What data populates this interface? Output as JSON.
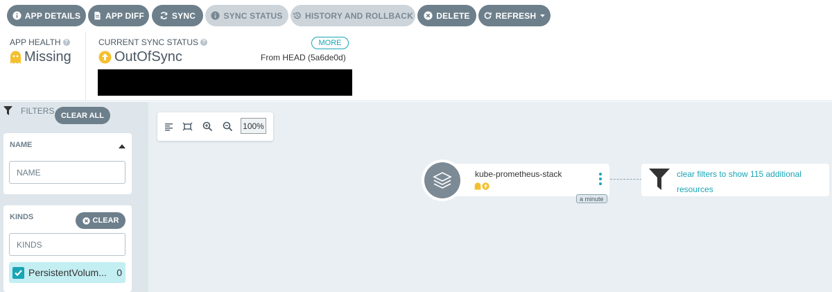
{
  "toolbar": {
    "app_details": "APP DETAILS",
    "app_diff": "APP DIFF",
    "sync": "SYNC",
    "sync_status": "SYNC STATUS",
    "history": "HISTORY AND ROLLBACK",
    "delete": "DELETE",
    "refresh": "REFRESH"
  },
  "status": {
    "health_label": "APP HEALTH",
    "health_value": "Missing",
    "sync_label": "CURRENT SYNC STATUS",
    "sync_value": "OutOfSync",
    "more": "MORE",
    "from_head": "From HEAD (5a6de0d)"
  },
  "filters": {
    "title": "FILTERS",
    "clear_all": "CLEAR ALL",
    "name": {
      "title": "NAME",
      "placeholder": "NAME"
    },
    "kinds": {
      "title": "KINDS",
      "clear": "CLEAR",
      "placeholder": "KINDS",
      "items": [
        {
          "label": "PersistentVolum...",
          "count": "0",
          "checked": true
        }
      ]
    }
  },
  "graph": {
    "zoom": "100%",
    "node": {
      "name": "kube-prometheus-stack",
      "age": "a minute"
    },
    "hidden_resources": "clear filters to show 115 additional resources"
  },
  "colors": {
    "button": "#6d7f8b",
    "button_disabled": "#cdd5db",
    "accent": "#18a5b5",
    "warning": "#f4c030",
    "canvas_bg": "#e9eff3",
    "sidebar_bg": "#dee6eb"
  }
}
